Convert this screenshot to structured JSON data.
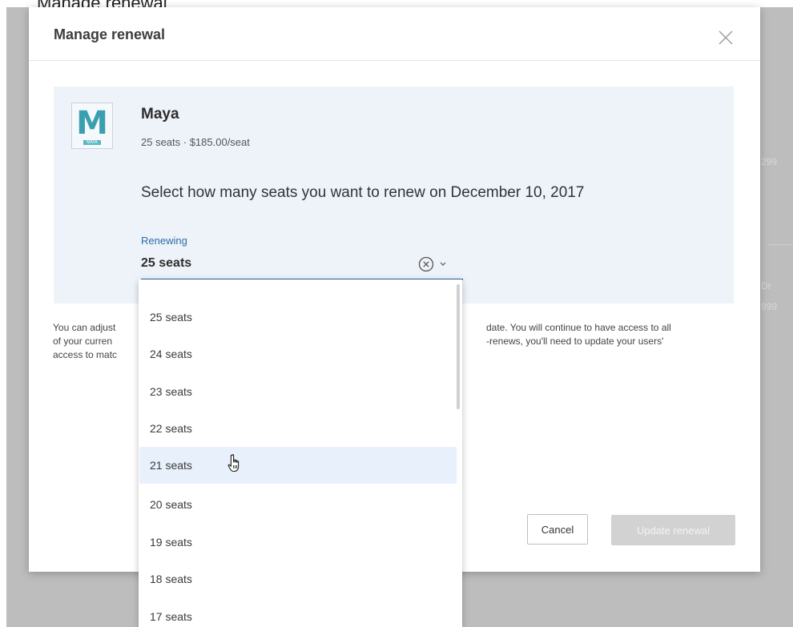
{
  "caption": "Manage renewal",
  "modal": {
    "title": "Manage renewal",
    "close_icon": "close-icon"
  },
  "product": {
    "logo_letter": "M",
    "logo_tag": "MAYA",
    "name": "Maya",
    "meta": "25 seats · $185.00/seat"
  },
  "prompt": "Select how many seats you want to renew on December 10, 2017",
  "renewing": {
    "label": "Renewing",
    "value": "25 seats"
  },
  "helper": {
    "line1_left": "You can adjust",
    "line1_right": "date. You will continue to have access to all",
    "line2_left": "of your curren",
    "line2_right": "-renews, you'll need to update your users'",
    "line3_left": "access to matc"
  },
  "buttons": {
    "cancel": "Cancel",
    "update": "Update renewal"
  },
  "dropdown": {
    "options": [
      "25 seats",
      "24 seats",
      "23 seats",
      "22 seats",
      "21 seats",
      "20 seats",
      "19 seats",
      "18 seats",
      "17 seats"
    ],
    "hovered": "21 seats"
  },
  "background": {
    "fragments": [
      "299",
      "Dr",
      "999"
    ]
  },
  "colors": {
    "accent": "#2a6aa6",
    "panel_bg": "#eef3fa",
    "hover_bg": "#e7f0fb",
    "disabled_btn": "#d2d2d2"
  }
}
